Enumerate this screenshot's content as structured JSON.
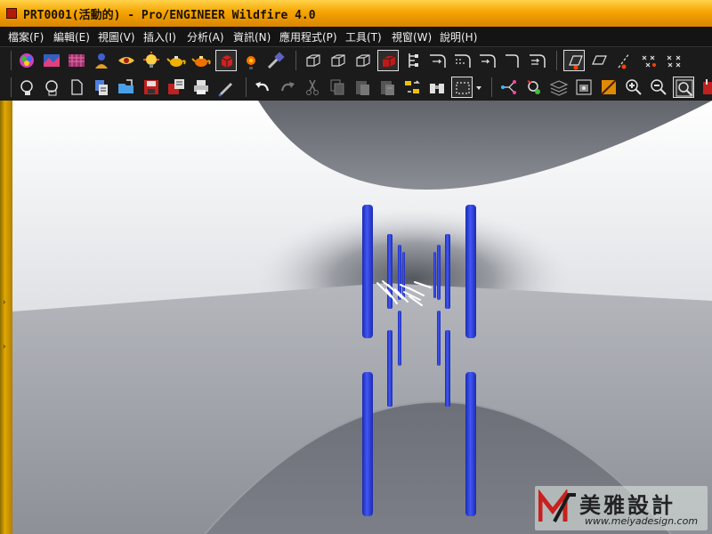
{
  "window": {
    "title": "PRT0001(活動的) - Pro/ENGINEER Wildfire 4.0"
  },
  "menu": [
    {
      "label": "檔案(F)"
    },
    {
      "label": "編輯(E)"
    },
    {
      "label": "視圖(V)"
    },
    {
      "label": "插入(I)"
    },
    {
      "label": "分析(A)"
    },
    {
      "label": "資訊(N)"
    },
    {
      "label": "應用程式(P)"
    },
    {
      "label": "工具(T)"
    },
    {
      "label": "視窗(W)"
    },
    {
      "label": "說明(H)"
    }
  ],
  "toolbar_top": [
    "appearance-icon",
    "shading-icon",
    "texture-icon",
    "person-icon",
    "eye-icon",
    "lightbulb-icon",
    "teapot-icon",
    "teapot-color-icon",
    "solid-cube-icon",
    "orient-icon",
    "tools-icon",
    "view-cube-1-icon",
    "view-cube-2-icon",
    "view-cube-3-icon",
    "shaded-cube-icon",
    "datum-display-icon",
    "round-icon-1",
    "round-icon-2",
    "round-icon-3",
    "round-icon-4",
    "round-icon-5",
    "datum-plane-icon",
    "datum-axis-icon",
    "datum-point-icon",
    "coord-sys-icon"
  ],
  "toolbar_bottom": [
    "new-window-icon",
    "open-window-icon",
    "new-file-icon",
    "open-list-icon",
    "open-folder-icon",
    "save-icon",
    "save-copy-icon",
    "print-icon",
    "edit-icon",
    "undo-icon",
    "redo-icon",
    "cut-icon",
    "copy-icon",
    "paste-icon",
    "paste-special-icon",
    "regenerate-icon",
    "binoculars-icon",
    "select-box-icon",
    "dropdown-arrow-icon",
    "model-tree-icon",
    "settings-icon",
    "layers-icon",
    "view-manager-icon",
    "spin-center-icon",
    "zoom-in-icon",
    "zoom-out-icon",
    "refit-icon",
    "repaint-icon"
  ],
  "colors": {
    "title_bar": "#f5a400",
    "part_blue": "#2238e0",
    "menu_bg": "#141414"
  },
  "watermark": {
    "brand": "美雅設計",
    "url": "www.meiyadesign.com"
  }
}
